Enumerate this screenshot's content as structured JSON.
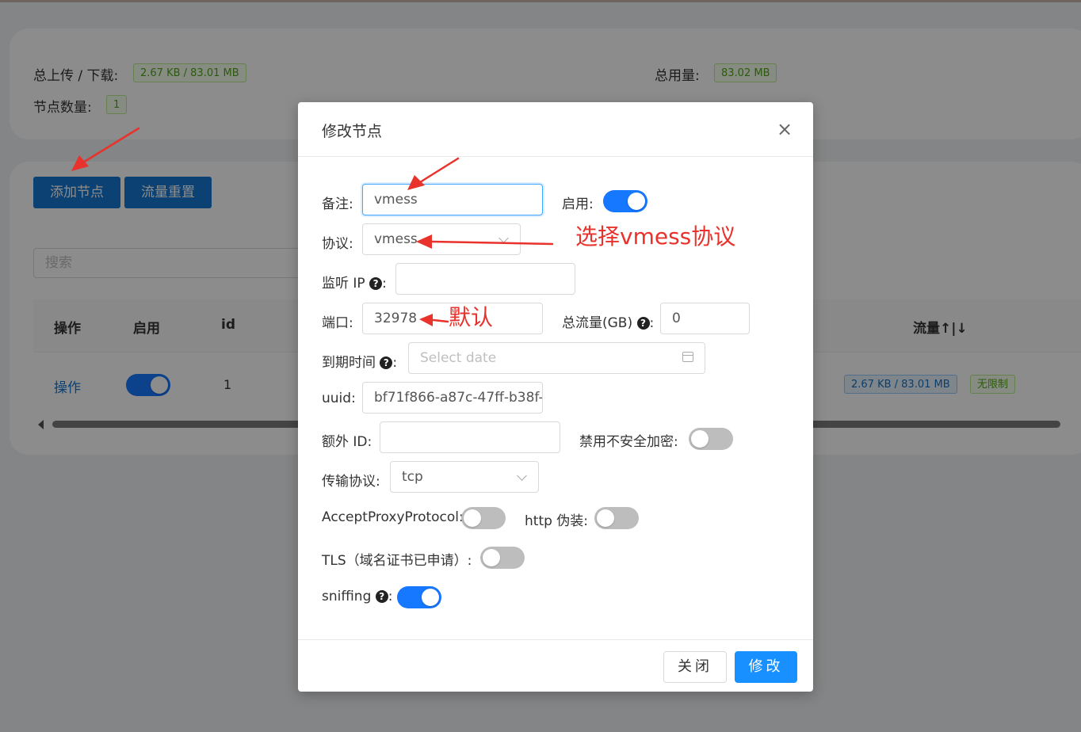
{
  "stats": {
    "upload_download_label": "总上传 / 下载:",
    "upload_download_value": "2.67 KB / 83.01 MB",
    "total_usage_label": "总用量:",
    "total_usage_value": "83.02 MB",
    "node_count_label": "节点数量:",
    "node_count_value": "1"
  },
  "toolbar": {
    "add_node": "添加节点",
    "reset_traffic": "流量重置"
  },
  "search": {
    "placeholder": "搜索"
  },
  "table": {
    "headers": {
      "action": "操作",
      "enable": "启用",
      "id": "id",
      "traffic": "流量↑|↓"
    },
    "row": {
      "action": "操作",
      "enabled": true,
      "id": "1",
      "traffic": "2.67 KB / 83.01 MB",
      "limit": "无限制"
    }
  },
  "modal": {
    "title": "修改节点",
    "close_icon": "×",
    "remark_label": "备注:",
    "remark_value": "vmess",
    "enable_label": "启用:",
    "enable_on": true,
    "protocol_label": "协议:",
    "protocol_value": "vmess",
    "listen_ip_label": "监听 IP",
    "listen_ip_value": "",
    "port_label": "端口:",
    "port_value": "32978",
    "total_traffic_label": "总流量(GB)",
    "total_traffic_value": "0",
    "expire_label": "到期时间",
    "expire_placeholder": "Select date",
    "uuid_label": "uuid:",
    "uuid_value": "bf71f866-a87c-47ff-b38f-",
    "alter_id_label": "额外 ID:",
    "alter_id_value": "",
    "disable_insecure_label": "禁用不安全加密:",
    "disable_insecure_on": false,
    "transport_label": "传输协议:",
    "transport_value": "tcp",
    "accept_proxy_label": "AcceptProxyProtocol:",
    "accept_proxy_on": false,
    "http_camouflage_label": "http 伪装:",
    "http_camouflage_on": false,
    "tls_label": "TLS（域名证书已申请）:",
    "tls_on": false,
    "sniffing_label": "sniffing",
    "sniffing_on": true,
    "cancel_button": "关闭",
    "ok_button": "修改",
    "help_icon": "?"
  },
  "annotations": {
    "select_protocol": "选择vmess协议",
    "default": "默认"
  },
  "colors": {
    "primary": "#1677d2",
    "switch_on": "#1677ff",
    "annotation": "#e8322b",
    "tag_green": "#52a41a"
  }
}
